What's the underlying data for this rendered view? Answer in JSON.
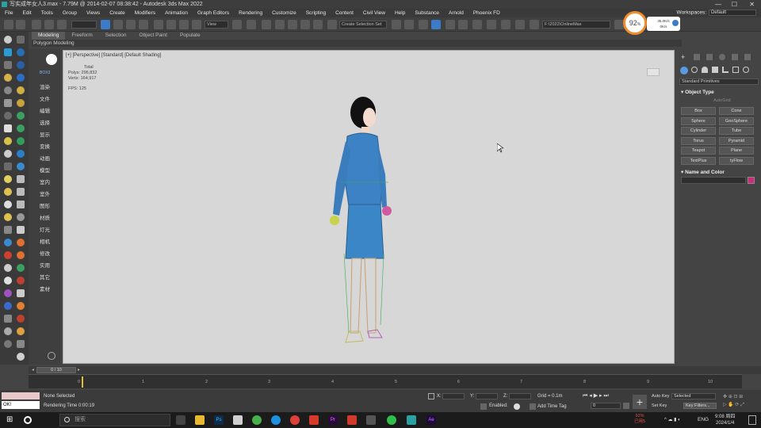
{
  "window": {
    "title": "写实成年女人3.max - 7.79M @ 2014-02-07 08:38:42 - Autodesk 3ds Max 2022",
    "min": "—",
    "max": "☐",
    "close": "✕"
  },
  "menu": [
    "File",
    "Edit",
    "Tools",
    "Group",
    "Views",
    "Create",
    "Modifiers",
    "Animation",
    "Graph Editors",
    "Rendering",
    "Customize",
    "Scripting",
    "Content",
    "Civil View",
    "Help",
    "Substance",
    "Arnold",
    "Phoenix FD"
  ],
  "workspace": {
    "label": "Workspaces:",
    "value": "Default"
  },
  "toolbar": {
    "ref_coord": "View",
    "selection_set": "Create Selection Set",
    "path": "F:\\2022\\OnlineMax"
  },
  "perf": {
    "percent": "92",
    "percent_unit": "%",
    "up": "35.0K/s",
    "down": "0K/s"
  },
  "ribbon": {
    "tabs": [
      "Modeling",
      "Freeform",
      "Selection",
      "Object Paint",
      "Populate"
    ],
    "subtitle": "Polygon Modeling"
  },
  "cmd_panel": [
    "渲染",
    "文件",
    "编辑",
    "选择",
    "显示",
    "变换",
    "动画",
    "模型",
    "室内",
    "室外",
    "图形",
    "材质",
    "灯光",
    "相机",
    "修改",
    "实用",
    "其它",
    "素材"
  ],
  "cmd_panel_top": "BOX3",
  "viewport": {
    "label": "[+] [Perspective] [Standard] [Default Shading]",
    "stats": {
      "total": "Total",
      "polys_label": "Polys:",
      "polys": "296,832",
      "verts_label": "Verts:",
      "verts": "164,917",
      "fps_label": "FPS:",
      "fps": "125"
    }
  },
  "right_panel": {
    "dropdown": "Standard Primitives",
    "object_type": "Object Type",
    "autogrid": "AutoGrid",
    "buttons": [
      "Box",
      "Cone",
      "Sphere",
      "GeoSphere",
      "Cylinder",
      "Tube",
      "Torus",
      "Pyramid",
      "Teapot",
      "Plane",
      "TextPlus",
      "tyFlow"
    ],
    "name_and_color": "Name and Color",
    "swatch_color": "#d02a7c"
  },
  "timeline": {
    "frame": "0 / 10",
    "ticks": [
      "0",
      "1",
      "2",
      "3",
      "4",
      "5",
      "6",
      "7",
      "8",
      "9",
      "10"
    ]
  },
  "status": {
    "selection": "None Selected",
    "rendering": "Rendering Time  0:00:19",
    "x": "X:",
    "y": "Y:",
    "z": "Z:",
    "grid": "Grid = 0.1m",
    "enabled": "Enabled:",
    "add_time_tag": "Add Time Tag",
    "auto_key": "Auto Key",
    "selected": "Selected",
    "set_key": "Set Key",
    "key_filters": "Key Filters...",
    "frame_field": "0",
    "maxscript_ok": "OK!"
  },
  "taskbar": {
    "search": "搜索",
    "time": "9:08 周四",
    "date": "2024/1/4",
    "lang": "ENG",
    "battery": "92%",
    "battery_sub": "已用1h",
    "stock": "已用5"
  }
}
